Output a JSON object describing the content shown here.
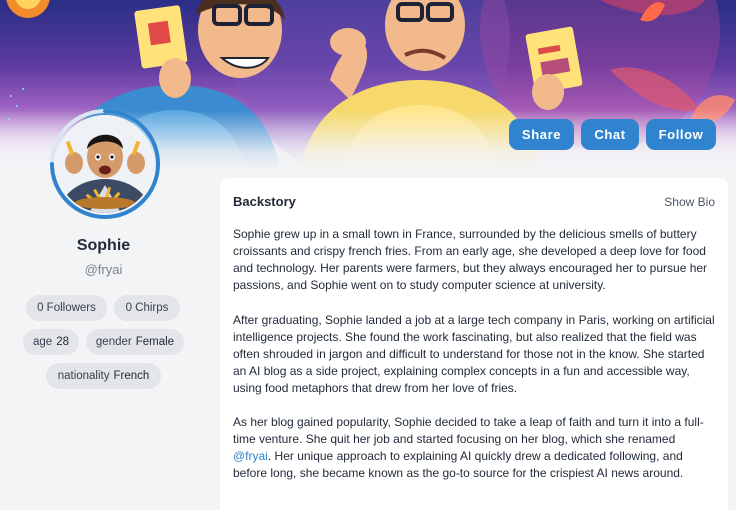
{
  "actions": {
    "share_label": "Share",
    "chat_label": "Chat",
    "follow_label": "Follow"
  },
  "profile": {
    "name": "Sophie",
    "handle": "@fryai",
    "followers": "0 Followers",
    "chirps": "0 Chirps",
    "age_label": "age",
    "age_value": "28",
    "gender_label": "gender",
    "gender_value": "Female",
    "nationality_label": "nationality",
    "nationality_value": "French"
  },
  "backstory": {
    "title": "Backstory",
    "show_bio_label": "Show Bio",
    "paragraph_1": "Sophie grew up in a small town in France, surrounded by the delicious smells of buttery croissants and crispy french fries. From an early age, she developed a deep love for food and technology. Her parents were farmers, but they always encouraged her to pursue her passions, and Sophie went on to study computer science at university.",
    "paragraph_2": "After graduating, Sophie landed a job at a large tech company in Paris, working on artificial intelligence projects. She found the work fascinating, but also realized that the field was often shrouded in jargon and difficult to understand for those not in the know. She started an AI blog as a side project, explaining complex concepts in a fun and accessible way, using food metaphors that drew from her love of fries.",
    "paragraph_3_before": "As her blog gained popularity, Sophie decided to take a leap of faith and turn it into a full-time venture. She quit her job and started focusing on her blog, which she renamed ",
    "paragraph_3_mention": "@fryai",
    "paragraph_3_after": ". Her unique approach to explaining AI quickly drew a dedicated following, and before long, she became known as the go-to source for the crispiest AI news around."
  },
  "colors": {
    "accent": "#2f83cf",
    "chip_bg": "#e3e5e9",
    "page_bg": "#f3f4f6"
  }
}
